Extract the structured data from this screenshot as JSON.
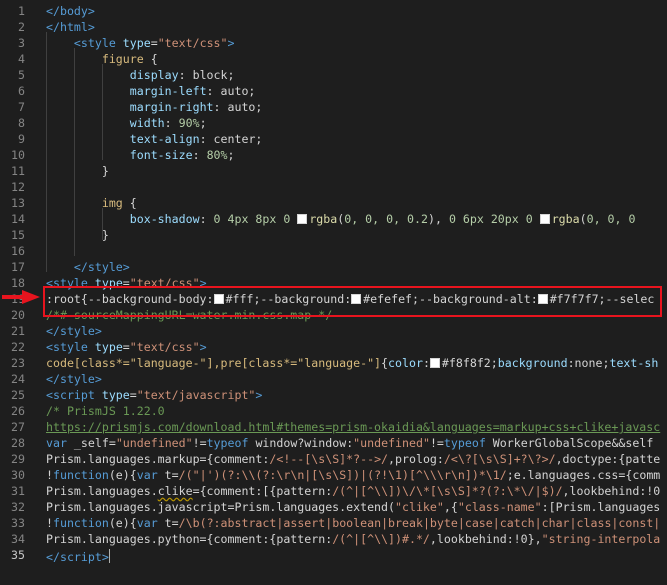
{
  "editor": {
    "language": "html",
    "accent_colors": {
      "tag": "#569cd6",
      "attr": "#9cdcfe",
      "string": "#ce9178",
      "number": "#b5cea8",
      "comment": "#6a9955",
      "annotation": "#e8141e"
    },
    "highlight_annotation": {
      "from_line": 19,
      "to_line": 20,
      "color": "#e8141e"
    },
    "lines": [
      {
        "n": "1",
        "tokens": [
          [
            "tag",
            "</body>"
          ]
        ]
      },
      {
        "n": "2",
        "tokens": [
          [
            "tag",
            "</html>"
          ]
        ]
      },
      {
        "n": "3",
        "tokens": [
          [
            "txt",
            "    "
          ],
          [
            "tag",
            "<style "
          ],
          [
            "attr",
            "type"
          ],
          [
            "txt",
            "="
          ],
          [
            "str",
            "\"text/css\""
          ],
          [
            "tag",
            ">"
          ]
        ]
      },
      {
        "n": "4",
        "tokens": [
          [
            "txt",
            "        "
          ],
          [
            "sel",
            "figure"
          ],
          [
            "txt",
            " {"
          ]
        ]
      },
      {
        "n": "5",
        "tokens": [
          [
            "txt",
            "            "
          ],
          [
            "attr",
            "display"
          ],
          [
            "txt",
            ": block;"
          ]
        ]
      },
      {
        "n": "6",
        "tokens": [
          [
            "txt",
            "            "
          ],
          [
            "attr",
            "margin-left"
          ],
          [
            "txt",
            ": auto;"
          ]
        ]
      },
      {
        "n": "7",
        "tokens": [
          [
            "txt",
            "            "
          ],
          [
            "attr",
            "margin-right"
          ],
          [
            "txt",
            ": auto;"
          ]
        ]
      },
      {
        "n": "8",
        "tokens": [
          [
            "txt",
            "            "
          ],
          [
            "attr",
            "width"
          ],
          [
            "txt",
            ": "
          ],
          [
            "num",
            "90%"
          ],
          [
            "txt",
            ";"
          ]
        ]
      },
      {
        "n": "9",
        "tokens": [
          [
            "txt",
            "            "
          ],
          [
            "attr",
            "text-align"
          ],
          [
            "txt",
            ": center;"
          ]
        ]
      },
      {
        "n": "10",
        "tokens": [
          [
            "txt",
            "            "
          ],
          [
            "attr",
            "font-size"
          ],
          [
            "txt",
            ": "
          ],
          [
            "num",
            "80%"
          ],
          [
            "txt",
            ";"
          ]
        ]
      },
      {
        "n": "11",
        "tokens": [
          [
            "txt",
            "        }"
          ]
        ]
      },
      {
        "n": "12",
        "tokens": []
      },
      {
        "n": "13",
        "tokens": [
          [
            "txt",
            "        "
          ],
          [
            "sel",
            "img"
          ],
          [
            "txt",
            " {"
          ]
        ]
      },
      {
        "n": "14",
        "tokens": [
          [
            "txt",
            "            "
          ],
          [
            "attr",
            "box-shadow"
          ],
          [
            "txt",
            ": "
          ],
          [
            "num",
            "0 4px 8px 0 "
          ],
          [
            "sw",
            ""
          ],
          [
            "fn",
            "rgba"
          ],
          [
            "txt",
            "("
          ],
          [
            "num",
            "0, 0, 0, 0.2"
          ],
          [
            "txt",
            "), "
          ],
          [
            "num",
            "0 6px 20px 0 "
          ],
          [
            "sw",
            ""
          ],
          [
            "fn",
            "rgba"
          ],
          [
            "txt",
            "("
          ],
          [
            "num",
            "0, 0, 0"
          ]
        ]
      },
      {
        "n": "15",
        "tokens": [
          [
            "txt",
            "        }"
          ]
        ]
      },
      {
        "n": "16",
        "tokens": []
      },
      {
        "n": "17",
        "tokens": [
          [
            "txt",
            "    "
          ],
          [
            "tag",
            "</style>"
          ]
        ]
      },
      {
        "n": "18",
        "tokens": [
          [
            "tag",
            "<style "
          ],
          [
            "attr",
            "type"
          ],
          [
            "txt",
            "="
          ],
          [
            "str",
            "\"text/css\""
          ],
          [
            "tag",
            ">"
          ]
        ]
      },
      {
        "n": "19",
        "tokens": [
          [
            "txt",
            ":root{--background-body:"
          ],
          [
            "sw",
            ""
          ],
          [
            "txt",
            "#fff;--background:"
          ],
          [
            "sw",
            ""
          ],
          [
            "txt",
            "#efefef;--background-alt:"
          ],
          [
            "sw",
            ""
          ],
          [
            "txt",
            "#f7f7f7;--selec"
          ]
        ]
      },
      {
        "n": "20",
        "tokens": [
          [
            "com",
            "/*# sourceMappingURL=water.min.css.map */"
          ]
        ]
      },
      {
        "n": "21",
        "tokens": [
          [
            "tag",
            "</style>"
          ]
        ]
      },
      {
        "n": "22",
        "tokens": [
          [
            "tag",
            "<style "
          ],
          [
            "attr",
            "type"
          ],
          [
            "txt",
            "="
          ],
          [
            "str",
            "\"text/css\""
          ],
          [
            "tag",
            ">"
          ]
        ]
      },
      {
        "n": "23",
        "tokens": [
          [
            "sel",
            "code[class*=\"language-\"],pre[class*=\"language-\"]"
          ],
          [
            "txt",
            "{"
          ],
          [
            "attr",
            "color"
          ],
          [
            "txt",
            ":"
          ],
          [
            "sw",
            ""
          ],
          [
            "txt",
            "#f8f8f2;"
          ],
          [
            "attr",
            "background"
          ],
          [
            "txt",
            ":none;"
          ],
          [
            "attr",
            "text-sh"
          ]
        ]
      },
      {
        "n": "24",
        "tokens": [
          [
            "tag",
            "</style>"
          ]
        ]
      },
      {
        "n": "25",
        "tokens": [
          [
            "tag",
            "<script "
          ],
          [
            "attr",
            "type"
          ],
          [
            "txt",
            "="
          ],
          [
            "str",
            "\"text/javascript\""
          ],
          [
            "tag",
            ">"
          ]
        ]
      },
      {
        "n": "26",
        "tokens": [
          [
            "com",
            "/* PrismJS 1.22.0"
          ]
        ]
      },
      {
        "n": "27",
        "tokens": [
          [
            "link",
            "https://prismjs.com/download.html#themes=prism-okaidia&languages=markup+css+clike+javasc"
          ]
        ]
      },
      {
        "n": "28",
        "tokens": [
          [
            "kw",
            "var"
          ],
          [
            "txt",
            " _self="
          ],
          [
            "str",
            "\"undefined\""
          ],
          [
            "txt",
            "!="
          ],
          [
            "kw",
            "typeof"
          ],
          [
            "txt",
            " window?window:"
          ],
          [
            "str",
            "\"undefined\""
          ],
          [
            "txt",
            "!="
          ],
          [
            "kw",
            "typeof"
          ],
          [
            "txt",
            " WorkerGlobalScope&&self"
          ]
        ]
      },
      {
        "n": "29",
        "tokens": [
          [
            "txt",
            "Prism.languages.markup={comment:"
          ],
          [
            "str",
            "/<!--[\\s\\S]*?-->/"
          ],
          [
            "txt",
            ",prolog:"
          ],
          [
            "str",
            "/<\\?[\\s\\S]+?\\?>/"
          ],
          [
            "txt",
            ",doctype:{patte"
          ]
        ]
      },
      {
        "n": "30",
        "tokens": [
          [
            "txt",
            "!"
          ],
          [
            "kw",
            "function"
          ],
          [
            "txt",
            "(e){"
          ],
          [
            "kw",
            "var"
          ],
          [
            "txt",
            " t="
          ],
          [
            "str",
            "/(\"|')(?:\\\\(?:\\r\\n|[\\s\\S])|(?!\\1)[^\\\\\\r\\n])*\\1/"
          ],
          [
            "txt",
            ";e.languages.css={comm"
          ]
        ]
      },
      {
        "n": "31",
        "tokens": [
          [
            "txt",
            "Prism.languages."
          ],
          [
            "warn",
            "clike"
          ],
          [
            "txt",
            "={comment:[{pattern:"
          ],
          [
            "str",
            "/(^|[^\\\\])\\/\\*[\\s\\S]*?(?:\\*\\/|$)/"
          ],
          [
            "txt",
            ",lookbehind:!0"
          ]
        ]
      },
      {
        "n": "32",
        "tokens": [
          [
            "txt",
            "Prism.languages.javascript=Prism.languages.extend("
          ],
          [
            "str",
            "\"clike\""
          ],
          [
            "txt",
            ",{"
          ],
          [
            "str",
            "\"class-name\""
          ],
          [
            "txt",
            ":[Prism.languages"
          ]
        ]
      },
      {
        "n": "33",
        "tokens": [
          [
            "txt",
            "!"
          ],
          [
            "kw",
            "function"
          ],
          [
            "txt",
            "(e){"
          ],
          [
            "kw",
            "var"
          ],
          [
            "txt",
            " t="
          ],
          [
            "str",
            "/\\b(?:abstract|assert|boolean|break|byte|case|catch|char|class|const|"
          ]
        ]
      },
      {
        "n": "34",
        "tokens": [
          [
            "txt",
            "Prism.languages.python={comment:{pattern:"
          ],
          [
            "str",
            "/(^|[^\\\\])#.*/"
          ],
          [
            "txt",
            ",lookbehind:!0},"
          ],
          [
            "str",
            "\"string-interpola"
          ]
        ]
      },
      {
        "n": "35",
        "tokens": [
          [
            "tag",
            "</"
          ],
          [
            "tag",
            "script"
          ],
          [
            "tag",
            ">"
          ]
        ]
      }
    ]
  }
}
